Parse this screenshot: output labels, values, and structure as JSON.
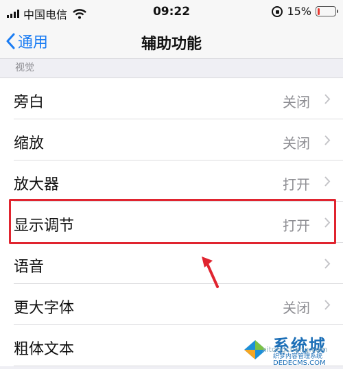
{
  "status_bar": {
    "carrier": "中国电信",
    "time": "09:22",
    "battery_percent": "15%",
    "battery_level": 0.15,
    "battery_color": "#e8382f"
  },
  "nav": {
    "back_label": "通用",
    "title": "辅助功能"
  },
  "section": {
    "header": "视觉"
  },
  "rows": [
    {
      "label": "旁白",
      "value": "关闭"
    },
    {
      "label": "缩放",
      "value": "关闭"
    },
    {
      "label": "放大器",
      "value": "打开"
    },
    {
      "label": "显示调节",
      "value": "打开"
    },
    {
      "label": "语音",
      "value": ""
    },
    {
      "label": "更大字体",
      "value": "关闭"
    },
    {
      "label": "粗体文本",
      "value": ""
    }
  ],
  "annotation": {
    "highlight_color": "#e0242f"
  },
  "watermark": {
    "brand": "系统城",
    "sub": "织梦内容管理系统",
    "url": "DEDECMS.COM",
    "site": "xitongcheng.com"
  },
  "colors": {
    "accent": "#1a7cf3",
    "background": "#efeff4"
  },
  "icons": [
    "signal-icon",
    "wifi-icon",
    "rotation-lock-icon",
    "battery-icon",
    "back-chevron-icon",
    "chevron-right-icon",
    "arrow-annotation-icon"
  ]
}
